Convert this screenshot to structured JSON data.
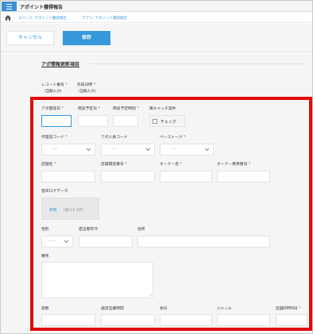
{
  "app": {
    "title": "アポイント獲得報告"
  },
  "breadcrumb": {
    "space": "スペース: アポイント獲得報告",
    "app": "アプリ: アポイント獲得報告"
  },
  "toolbar": {
    "cancel_label": "キャンセル",
    "save_label": "保存"
  },
  "group": {
    "title": "アポ情報更新項目"
  },
  "fields": {
    "record_number": {
      "label": "レコード番号",
      "value": "(自動入力)"
    },
    "created_at": {
      "label": "作成日時",
      "value": "(自動入力)"
    },
    "appoint_date": {
      "label": "アポ獲得日"
    },
    "visit_date": {
      "label": "商談予定日"
    },
    "visit_time": {
      "label": "商談予定時刻"
    },
    "recatch": {
      "label": "再キャッチ案件",
      "option": "チェック"
    },
    "agent_code": {
      "label": "代理店コード",
      "value": "-----"
    },
    "agent_person_code": {
      "label": "アポ人員コード",
      "value": "-----"
    },
    "base_talk": {
      "label": "ベーストーク",
      "value": "-----"
    },
    "store_name": {
      "label": "店舗名"
    },
    "store_phone": {
      "label": "店舗電話番号"
    },
    "owner_name": {
      "label": "オーナー名"
    },
    "owner_mobile": {
      "label": "オーナー携帯番号"
    },
    "audio_log": {
      "label": "音声ログデータ",
      "browse": "参照",
      "max": "(最大1 GB)"
    },
    "gender": {
      "label": "性別",
      "value": "-----"
    },
    "contact_age": {
      "label": "担当者年代"
    },
    "address": {
      "label": "住所"
    },
    "remarks": {
      "label": "備考"
    },
    "seats": {
      "label": "席数"
    },
    "business_hours": {
      "label": "通常営業時間"
    },
    "closed_days": {
      "label": "休日"
    },
    "genre": {
      "label": "ジャンル"
    },
    "store_open_date": {
      "label": "店舗OPEN日"
    }
  },
  "required_mark": "*",
  "colors": {
    "accent": "#3498db",
    "highlight": "#e00a0a",
    "required": "#e74c3c"
  }
}
